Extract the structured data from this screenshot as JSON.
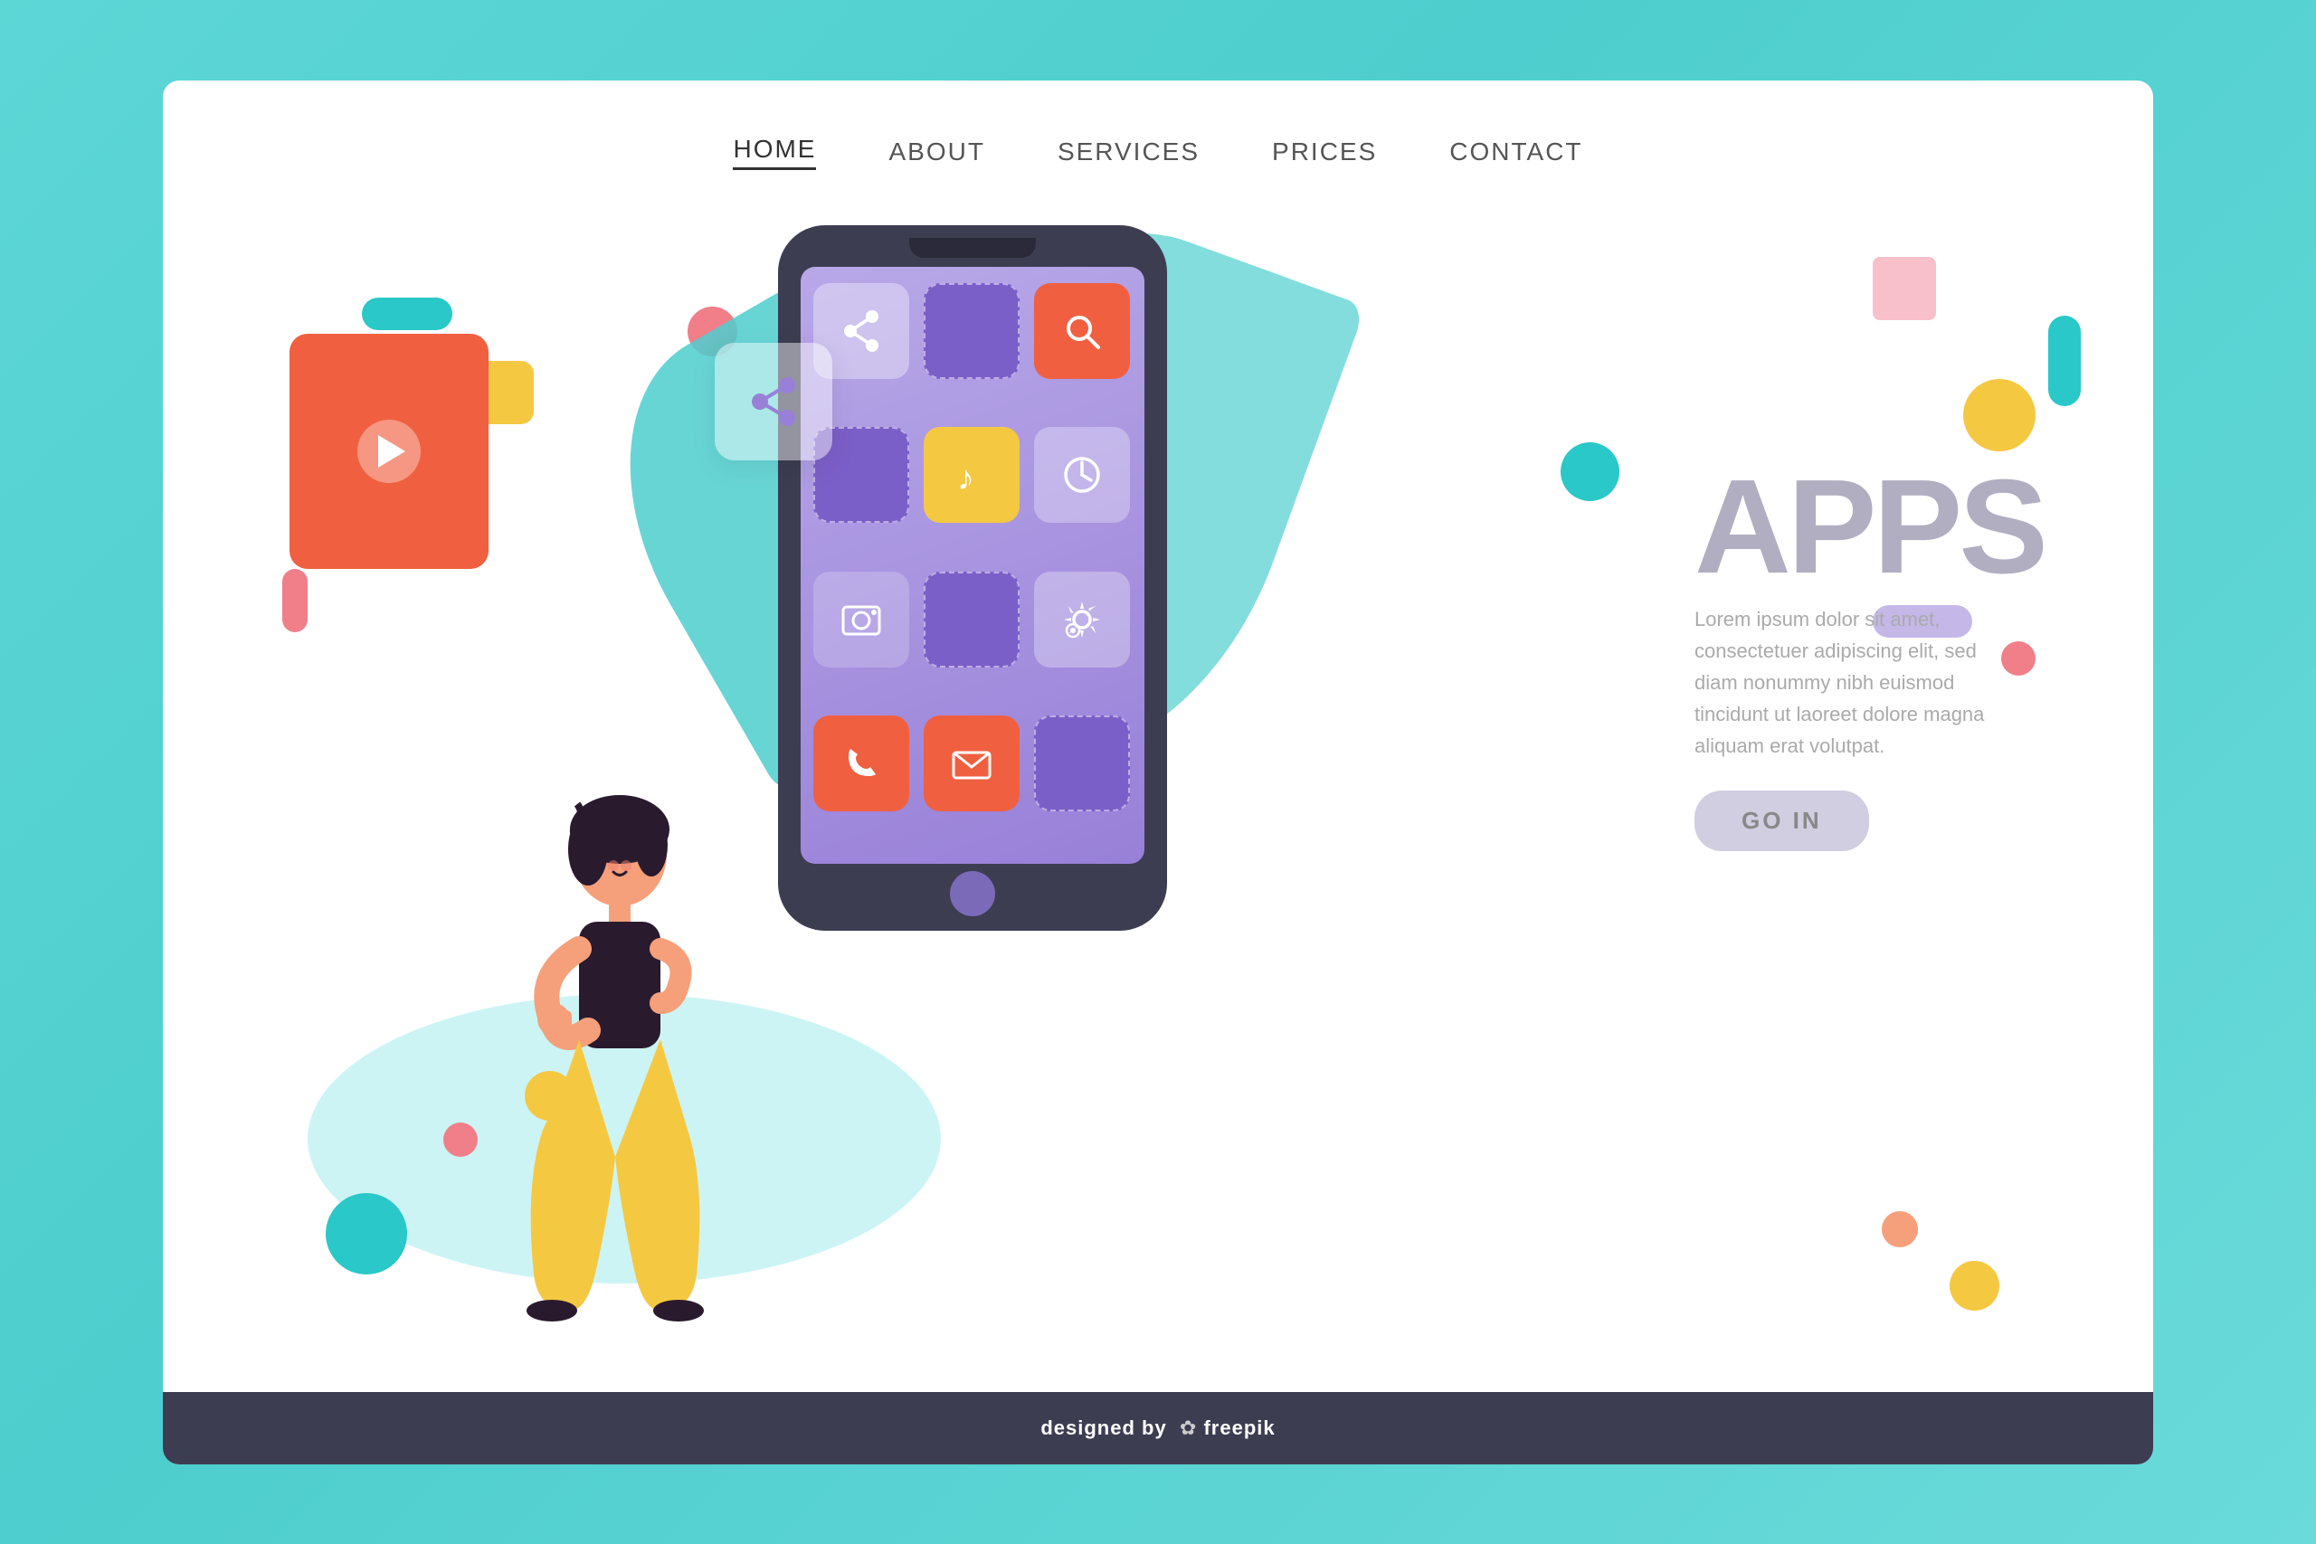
{
  "nav": {
    "items": [
      {
        "label": "HOME",
        "active": true
      },
      {
        "label": "ABOUT",
        "active": false
      },
      {
        "label": "SERVICES",
        "active": false
      },
      {
        "label": "PRICES",
        "active": false
      },
      {
        "label": "CONTACT",
        "active": false
      }
    ]
  },
  "hero": {
    "apps_title": "APPS",
    "description": "Lorem ipsum dolor sit amet, consectetuer adipiscing elit, sed diam nonummy nibh euismod tincidunt ut laoreet dolore magna aliquam erat volutpat.",
    "cta_label": "GO IN",
    "video_icon": "▶"
  },
  "footer": {
    "text": "designed by",
    "brand": "freepik"
  },
  "phone": {
    "apps": [
      {
        "type": "share",
        "icon": "⟨"
      },
      {
        "type": "purple",
        "icon": ""
      },
      {
        "type": "orange",
        "icon": "🔍"
      },
      {
        "type": "purple",
        "icon": ""
      },
      {
        "type": "yellow",
        "icon": "♪"
      },
      {
        "type": "gray",
        "icon": "🕐"
      },
      {
        "type": "photo",
        "icon": "🖼"
      },
      {
        "type": "purple",
        "icon": ""
      },
      {
        "type": "gray",
        "icon": "⚙"
      },
      {
        "type": "phone-icon",
        "icon": "📞"
      },
      {
        "type": "mail",
        "icon": "✉"
      },
      {
        "type": "purple",
        "icon": ""
      }
    ]
  }
}
